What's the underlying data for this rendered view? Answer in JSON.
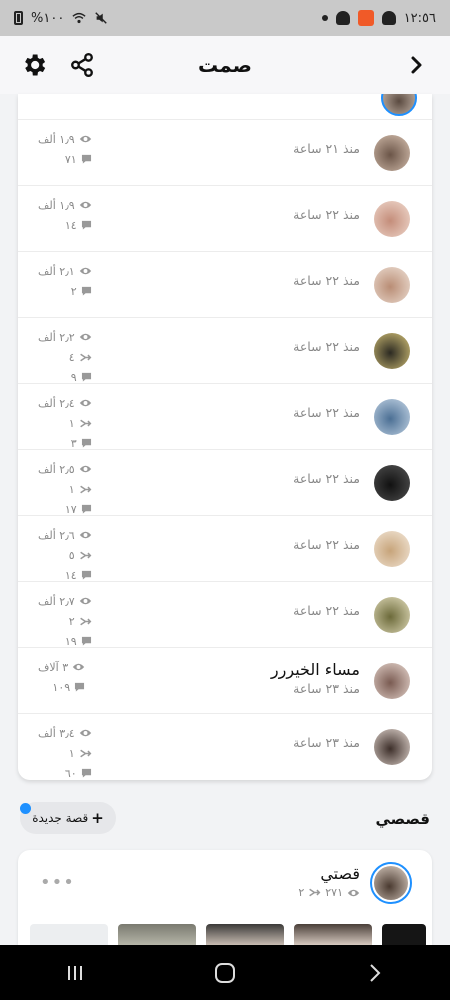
{
  "status_bar": {
    "time": "١٢:٥٦",
    "battery": "%١٠٠",
    "battery_icon": "battery-icon",
    "wifi_icon": "wifi-icon",
    "mute_icon": "mute-icon"
  },
  "header": {
    "title": "صمت",
    "back_icon": "chevron-left-icon",
    "share_icon": "share-icon",
    "settings_icon": "gear-icon"
  },
  "viewers": [
    {
      "name": "",
      "time": "منذ ٢١ ساعة",
      "views": "١٫٩ ألف",
      "screenshots": "",
      "replies": "٧١",
      "avatar_colors": [
        "#6b5548",
        "#d9c3b2"
      ]
    },
    {
      "name": "",
      "time": "منذ ٢٢ ساعة",
      "views": "١٫٩ ألف",
      "screenshots": "",
      "replies": "١٤",
      "avatar_colors": [
        "#c48d7a",
        "#f1dcd1"
      ]
    },
    {
      "name": "",
      "time": "منذ ٢٢ ساعة",
      "views": "٢٫١ ألف",
      "screenshots": "",
      "replies": "٢",
      "avatar_colors": [
        "#b98d75",
        "#efe2d8"
      ]
    },
    {
      "name": "",
      "time": "منذ ٢٢ ساعة",
      "views": "٢٫٢ ألف",
      "screenshots": "٤",
      "replies": "٩",
      "avatar_colors": [
        "#2c2a22",
        "#d9c67a"
      ]
    },
    {
      "name": "",
      "time": "منذ ٢٢ ساعة",
      "views": "٢٫٤ ألف",
      "screenshots": "١",
      "replies": "٣",
      "avatar_colors": [
        "#4b6f94",
        "#c8d8e8"
      ]
    },
    {
      "name": "",
      "time": "منذ ٢٢ ساعة",
      "views": "٢٫٥ ألف",
      "screenshots": "١",
      "replies": "١٧",
      "avatar_colors": [
        "#111111",
        "#555555"
      ]
    },
    {
      "name": "",
      "time": "منذ ٢٢ ساعة",
      "views": "٢٫٦ ألف",
      "screenshots": "٥",
      "replies": "١٤",
      "avatar_colors": [
        "#c7a47a",
        "#f4e9dc"
      ]
    },
    {
      "name": "",
      "time": "منذ ٢٢ ساعة",
      "views": "٢٫٧ ألف",
      "screenshots": "٢",
      "replies": "١٩",
      "avatar_colors": [
        "#6c6a3a",
        "#e6e0c0"
      ]
    },
    {
      "name": "مساء الخيررر",
      "time": "منذ ٢٣ ساعة",
      "views": "٣ آلاف",
      "screenshots": "",
      "replies": "١٠٩",
      "avatar_colors": [
        "#7a5b52",
        "#eadad2"
      ]
    },
    {
      "name": "",
      "time": "منذ ٢٣ ساعة",
      "views": "٣٫٤ ألف",
      "screenshots": "١",
      "replies": "٦٠",
      "avatar_colors": [
        "#3d2f2a",
        "#e8dcd5"
      ]
    }
  ],
  "stories_section": {
    "title": "قصصي",
    "new_story_label": "قصة جديدة",
    "new_story_icon": "plus-icon"
  },
  "my_story": {
    "name": "قصتي",
    "views": "٢٧١",
    "screenshots": "٢",
    "more_icon": "more-dots-icon"
  },
  "nav_bar": {
    "recents_icon": "recents-icon",
    "home_icon": "home-icon",
    "back_icon": "back-icon"
  },
  "colors": {
    "accent": "#1e90ff",
    "muted_text": "#888888",
    "background": "#f2f3f5"
  }
}
